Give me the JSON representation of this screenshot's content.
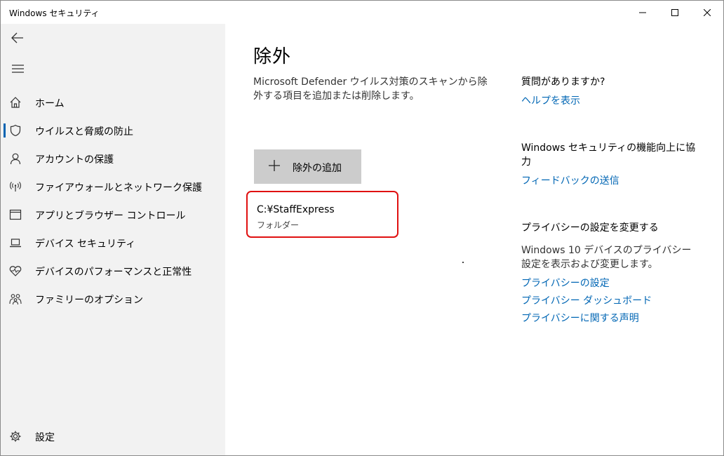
{
  "window": {
    "title": "Windows セキュリティ"
  },
  "sidebar": {
    "items": [
      {
        "label": "ホーム",
        "icon": "home-icon"
      },
      {
        "label": "ウイルスと脅威の防止",
        "icon": "shield-icon",
        "active": true
      },
      {
        "label": "アカウントの保護",
        "icon": "person-icon"
      },
      {
        "label": "ファイアウォールとネットワーク保護",
        "icon": "wifi-icon"
      },
      {
        "label": "アプリとブラウザー コントロール",
        "icon": "app-window-icon"
      },
      {
        "label": "デバイス セキュリティ",
        "icon": "laptop-icon"
      },
      {
        "label": "デバイスのパフォーマンスと正常性",
        "icon": "heart-pulse-icon"
      },
      {
        "label": "ファミリーのオプション",
        "icon": "family-icon"
      }
    ],
    "settings_label": "設定"
  },
  "main": {
    "title": "除外",
    "description": "Microsoft Defender ウイルス対策のスキャンから除外する項目を追加または削除します。",
    "add_button_label": "除外の追加",
    "exclusions": [
      {
        "path": "C:¥StaffExpress",
        "type": "フォルダー"
      }
    ]
  },
  "right": {
    "question_heading": "質問がありますか?",
    "help_link": "ヘルプを表示",
    "improve_heading": "Windows セキュリティの機能向上に協力",
    "feedback_link": "フィードバックの送信",
    "privacy_heading": "プライバシーの設定を変更する",
    "privacy_text": "Windows 10 デバイスのプライバシー設定を表示および変更します。",
    "privacy_links": [
      "プライバシーの設定",
      "プライバシー ダッシュボード",
      "プライバシーに関する声明"
    ]
  },
  "colors": {
    "accent": "#0063b1",
    "link": "#0066b4",
    "highlight_border": "#e01010",
    "sidebar_bg": "#f2f2f2",
    "button_bg": "#cccccc"
  }
}
